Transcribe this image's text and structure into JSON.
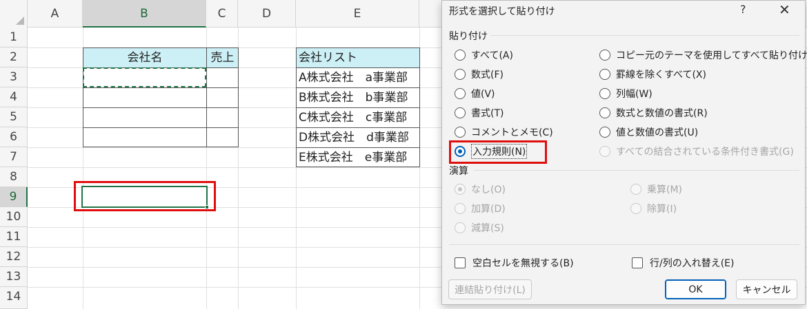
{
  "sheet": {
    "columns": [
      "A",
      "B",
      "C",
      "D",
      "E"
    ],
    "rows": [
      "1",
      "2",
      "3",
      "4",
      "5",
      "6",
      "7",
      "8",
      "9",
      "10",
      "11",
      "12",
      "13",
      "14"
    ],
    "table_headers": {
      "company": "会社名",
      "sales": "売上"
    },
    "list_header": "会社リスト",
    "list_items": [
      "A株式会社　a事業部",
      "B株式会社　b事業部",
      "C株式会社　c事業部",
      "D株式会社　d事業部",
      "E株式会社　e事業部"
    ]
  },
  "dialog": {
    "title": "形式を選択して貼り付け",
    "help": "?",
    "close": "✕",
    "paste_section": "貼り付け",
    "paste_left": [
      "すべて(A)",
      "数式(F)",
      "値(V)",
      "書式(T)",
      "コメントとメモ(C)",
      "入力規則(N)"
    ],
    "paste_right": [
      "コピー元のテーマを使用してすべて貼り付け(H)",
      "罫線を除くすべて(X)",
      "列幅(W)",
      "数式と数値の書式(R)",
      "値と数値の書式(U)",
      "すべての結合されている条件付き書式(G)"
    ],
    "operation_section": "演算",
    "op_left": [
      "なし(O)",
      "加算(D)",
      "減算(S)"
    ],
    "op_right": [
      "乗算(M)",
      "除算(I)"
    ],
    "skip_blanks": "空白セルを無視する(B)",
    "transpose": "行/列の入れ替え(E)",
    "paste_link": "連結貼り付け(L)",
    "ok": "OK",
    "cancel": "キャンセル"
  },
  "colors": {
    "accent": "#005fb8",
    "excel_green": "#217346",
    "highlight_red": "#e00d0d",
    "header_fill": "#ccf0f6"
  }
}
